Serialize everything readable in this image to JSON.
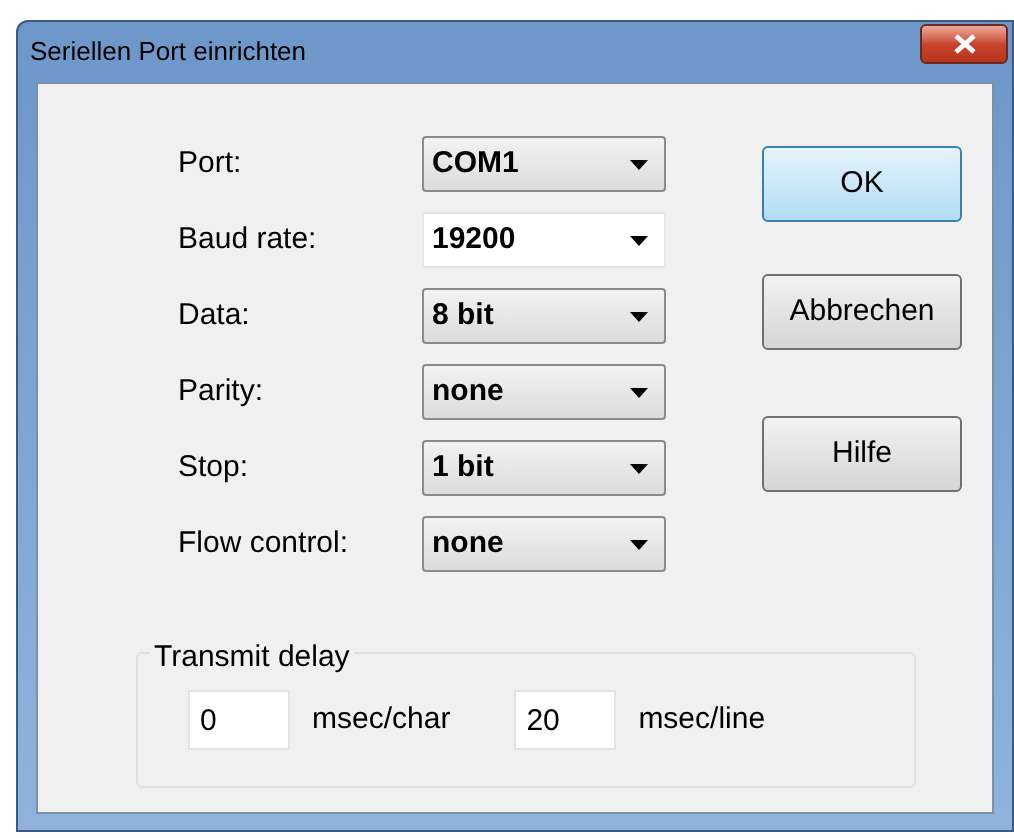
{
  "window": {
    "title": "Seriellen Port einrichten"
  },
  "fields": [
    {
      "label": "Port:",
      "value": "COM1",
      "kind": "dropdown"
    },
    {
      "label": "Baud rate:",
      "value": "19200",
      "kind": "editable"
    },
    {
      "label": "Data:",
      "value": "8 bit",
      "kind": "dropdown"
    },
    {
      "label": "Parity:",
      "value": "none",
      "kind": "dropdown"
    },
    {
      "label": "Stop:",
      "value": "1 bit",
      "kind": "dropdown"
    },
    {
      "label": "Flow control:",
      "value": "none",
      "kind": "dropdown"
    }
  ],
  "buttons": [
    {
      "label": "OK",
      "default": true
    },
    {
      "label": "Abbrechen",
      "default": false
    },
    {
      "label": "Hilfe",
      "default": false
    }
  ],
  "transmit_delay": {
    "title": "Transmit delay",
    "inputs": [
      {
        "value": "0",
        "unit": "msec/char"
      },
      {
        "value": "20",
        "unit": "msec/line"
      }
    ]
  }
}
